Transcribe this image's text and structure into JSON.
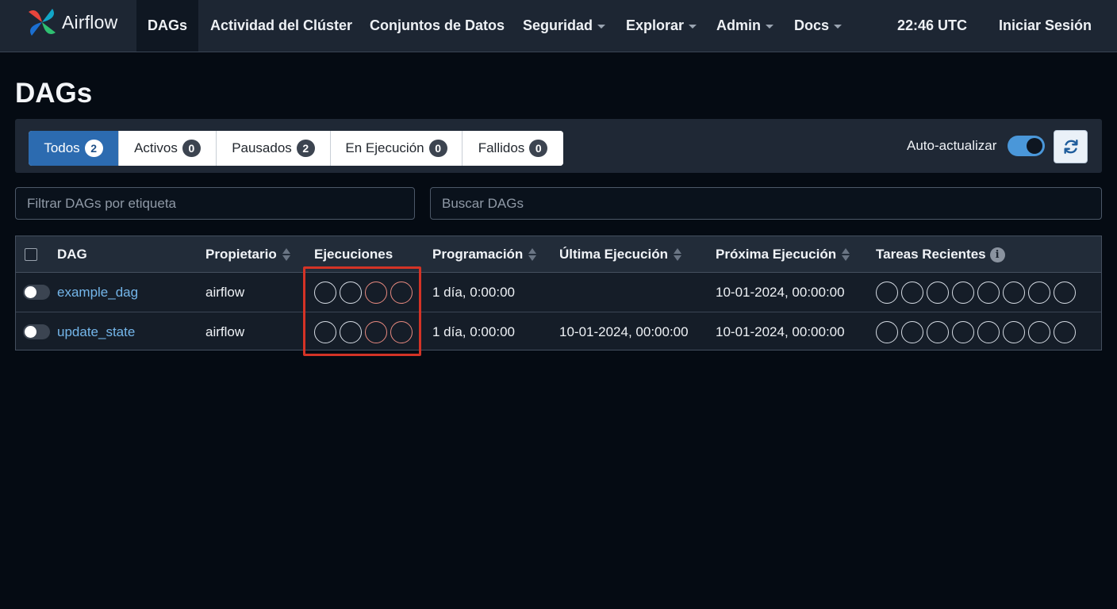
{
  "navbar": {
    "brand": "Airflow",
    "items": [
      {
        "label": "DAGs",
        "active": true
      },
      {
        "label": "Actividad del Clúster"
      },
      {
        "label": "Conjuntos de Datos"
      },
      {
        "label": "Seguridad",
        "dropdown": true
      },
      {
        "label": "Explorar",
        "dropdown": true
      },
      {
        "label": "Admin",
        "dropdown": true
      },
      {
        "label": "Docs",
        "dropdown": true
      }
    ],
    "clock": "22:46 UTC",
    "login": "Iniciar Sesión"
  },
  "page": {
    "title": "DAGs"
  },
  "status_filters": [
    {
      "label": "Todos",
      "count": "2",
      "active": true
    },
    {
      "label": "Activos",
      "count": "0"
    },
    {
      "label": "Pausados",
      "count": "2"
    },
    {
      "label": "En Ejecución",
      "count": "0"
    },
    {
      "label": "Fallidos",
      "count": "0"
    }
  ],
  "auto_refresh": {
    "label": "Auto-actualizar",
    "enabled": true
  },
  "search": {
    "tag_placeholder": "Filtrar DAGs por etiqueta",
    "dag_placeholder": "Buscar DAGs"
  },
  "table": {
    "headers": {
      "dag": "DAG",
      "owner": "Propietario",
      "runs": "Ejecuciones",
      "schedule": "Programación",
      "last_run": "Última Ejecución",
      "next_run": "Próxima Ejecución",
      "recent_tasks": "Tareas Recientes"
    },
    "info_glyph": "i",
    "rows": [
      {
        "dag_id": "example_dag",
        "owner": "airflow",
        "schedule": "1 día, 0:00:00",
        "last_run": "",
        "next_run": "10-01-2024, 00:00:00"
      },
      {
        "dag_id": "update_state",
        "owner": "airflow",
        "schedule": "1 día, 0:00:00",
        "last_run": "10-01-2024, 00:00:00",
        "next_run": "10-01-2024, 00:00:00"
      }
    ]
  },
  "colors": {
    "accent": "#2c6bb0",
    "link": "#74b6ea",
    "failed_ring": "#e7897f",
    "highlight": "#d43326"
  }
}
